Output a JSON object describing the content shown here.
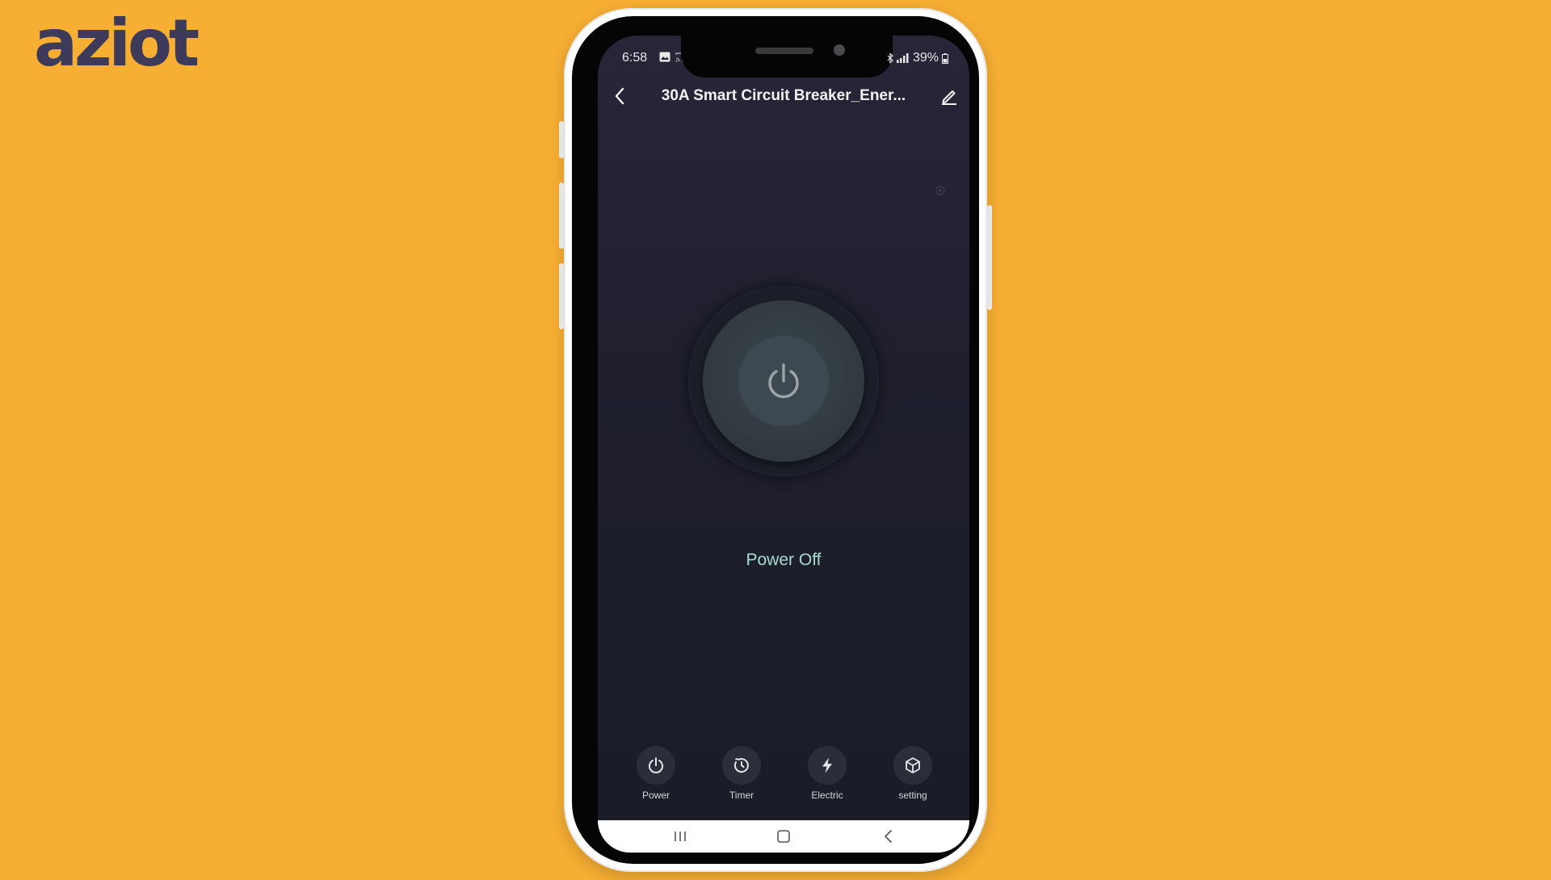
{
  "brand": {
    "logo_text": "aziot"
  },
  "status_bar": {
    "time": "6:58",
    "battery": "39%",
    "icons_left": [
      "image-icon",
      "cast-icon"
    ],
    "icons_right": [
      "bluetooth-icon",
      "signal-icon",
      "battery-icon"
    ]
  },
  "header": {
    "title": "30A Smart Circuit Breaker_Ener...",
    "back_icon": "chevron-left-icon",
    "edit_icon": "pencil-icon"
  },
  "device": {
    "status_text": "Power Off",
    "power_icon": "power-icon"
  },
  "tabs": [
    {
      "label": "Power",
      "icon": "power-icon"
    },
    {
      "label": "Timer",
      "icon": "timer-icon"
    },
    {
      "label": "Electric",
      "icon": "lightning-icon"
    },
    {
      "label": "setting",
      "icon": "cube-icon"
    }
  ],
  "system_nav": [
    "recent-apps-icon",
    "home-icon",
    "back-icon"
  ],
  "colors": {
    "background": "#F6AE33",
    "logo": "#3D3A5A",
    "screen_bg": "#1f1f2e",
    "status_accent": "#A8DCCC"
  }
}
